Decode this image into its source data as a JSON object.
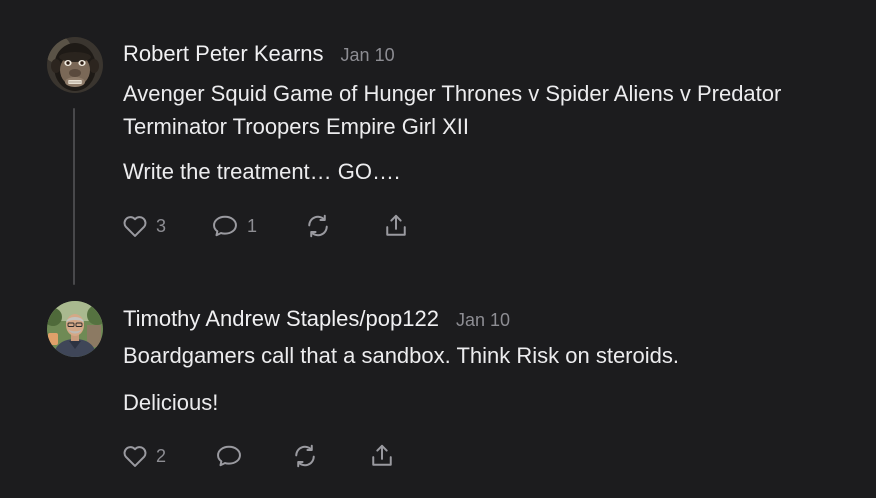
{
  "comments": [
    {
      "author": "Robert Peter Kearns",
      "date": "Jan 10",
      "avatar": "chimpanzee-avatar",
      "paragraphs": [
        "Avenger Squid Game of Hunger Thrones v Spider Aliens v Predator",
        "Terminator Troopers Empire Girl XII",
        "Write the treatment… GO…."
      ],
      "likes": "3",
      "replies": "1"
    },
    {
      "author": "Timothy Andrew Staples/pop122",
      "date": "Jan 10",
      "avatar": "man-photo-avatar",
      "paragraphs": [
        "Boardgamers call that a sandbox. Think Risk on steroids.",
        "Delicious!"
      ],
      "likes": "2",
      "replies": ""
    }
  ],
  "icons": {
    "like": "heart-icon",
    "reply": "speech-bubble-icon",
    "restack": "restack-arrows-icon",
    "share": "share-upload-icon"
  },
  "colors": {
    "background": "#1c1c1e",
    "text": "#ececee",
    "muted": "#8d8d93",
    "thread_line": "#48484b"
  }
}
